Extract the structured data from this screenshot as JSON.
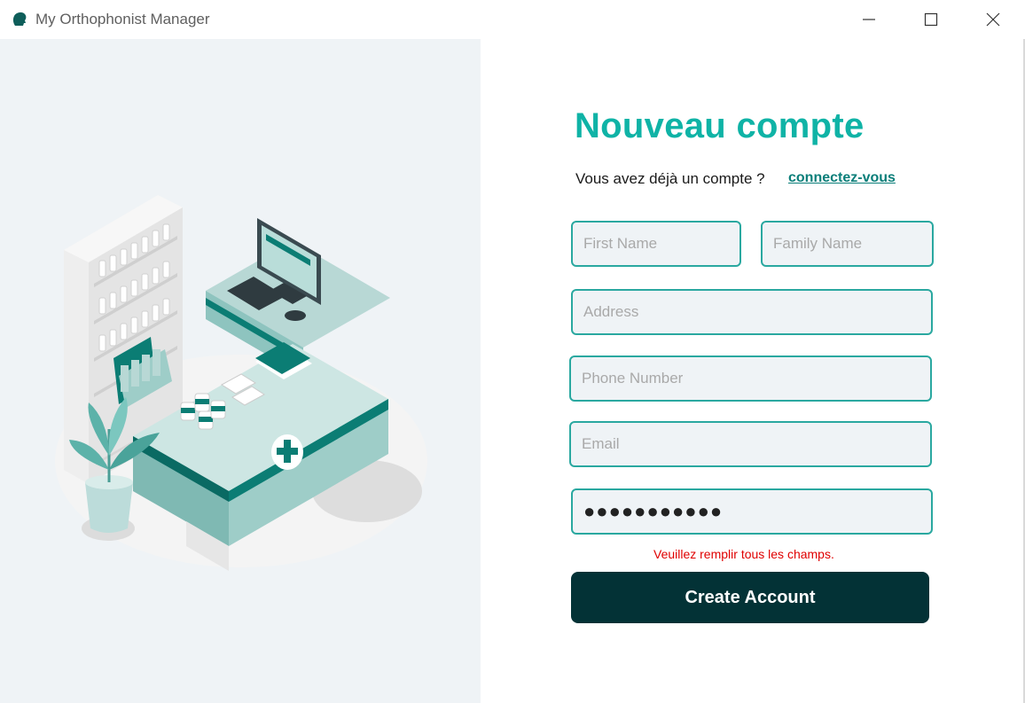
{
  "window": {
    "title": "My Orthophonist Manager",
    "icon": "head-silhouette-icon"
  },
  "illustration": {
    "icon": "pharmacy-counter-illustration"
  },
  "form": {
    "heading": "Nouveau compte",
    "subtitle": "Vous avez déjà un compte ?",
    "login_link": "connectez-vous",
    "fields": {
      "first_name": {
        "placeholder": "First Name",
        "value": ""
      },
      "family_name": {
        "placeholder": "Family Name",
        "value": ""
      },
      "address": {
        "placeholder": "Address",
        "value": ""
      },
      "phone": {
        "placeholder": "Phone Number",
        "value": ""
      },
      "email": {
        "placeholder": "Email",
        "value": ""
      },
      "password": {
        "value": "●●●●●●●●●●●"
      }
    },
    "error": "Veuillez remplir tous les champs.",
    "submit_label": "Create Account"
  },
  "colors": {
    "accent": "#0fb3a6",
    "link": "#0a7e79",
    "field_border": "#2aa8a0",
    "button": "#033236",
    "error": "#e00000"
  }
}
